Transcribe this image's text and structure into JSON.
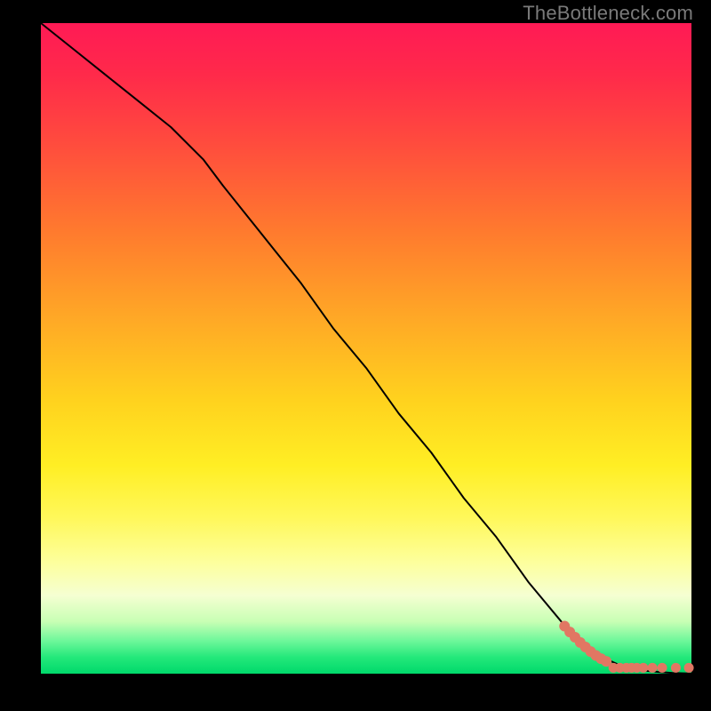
{
  "watermark": "TheBottleneck.com",
  "chart_data": {
    "type": "line",
    "title": "",
    "xlabel": "",
    "ylabel": "",
    "xlim": [
      0,
      100
    ],
    "ylim": [
      0,
      100
    ],
    "grid": false,
    "legend": false,
    "series": [
      {
        "name": "curve",
        "style": "line",
        "color": "#000000",
        "x": [
          0,
          5,
          10,
          15,
          20,
          25,
          28,
          32,
          36,
          40,
          45,
          50,
          55,
          60,
          65,
          70,
          75,
          80,
          83,
          85,
          87,
          89,
          91,
          93,
          95,
          97,
          99,
          100
        ],
        "y": [
          100,
          96,
          92,
          88,
          84,
          79,
          75,
          70,
          65,
          60,
          53,
          47,
          40,
          34,
          27,
          21,
          14,
          8,
          5,
          3.5,
          2.2,
          1.3,
          0.8,
          0.45,
          0.25,
          0.12,
          0.05,
          0.02
        ]
      },
      {
        "name": "points-on-curve",
        "style": "scatter",
        "color": "#e17763",
        "radius": 6,
        "x": [
          80.5,
          81.3,
          82.1,
          82.9,
          83.7,
          84.5,
          85.3,
          86.1,
          86.9
        ],
        "y": [
          7.3,
          6.4,
          5.6,
          4.8,
          4.1,
          3.4,
          2.8,
          2.3,
          1.9
        ]
      },
      {
        "name": "points-flat",
        "style": "scatter",
        "color": "#e17763",
        "radius": 5.5,
        "x": [
          88.0,
          89.0,
          90.0,
          90.8,
          91.6,
          92.6,
          94.0,
          95.5,
          97.6,
          99.6
        ],
        "y": [
          0.9,
          0.9,
          0.9,
          0.9,
          0.9,
          0.9,
          0.9,
          0.9,
          0.9,
          0.9
        ]
      }
    ],
    "background_gradient": {
      "direction": "top-to-bottom",
      "stops": [
        {
          "pos": 0.0,
          "color": "#ff1a55"
        },
        {
          "pos": 0.18,
          "color": "#ff4a3e"
        },
        {
          "pos": 0.45,
          "color": "#ffa726"
        },
        {
          "pos": 0.68,
          "color": "#ffee24"
        },
        {
          "pos": 0.88,
          "color": "#f5ffd2"
        },
        {
          "pos": 1.0,
          "color": "#00d96b"
        }
      ]
    }
  }
}
